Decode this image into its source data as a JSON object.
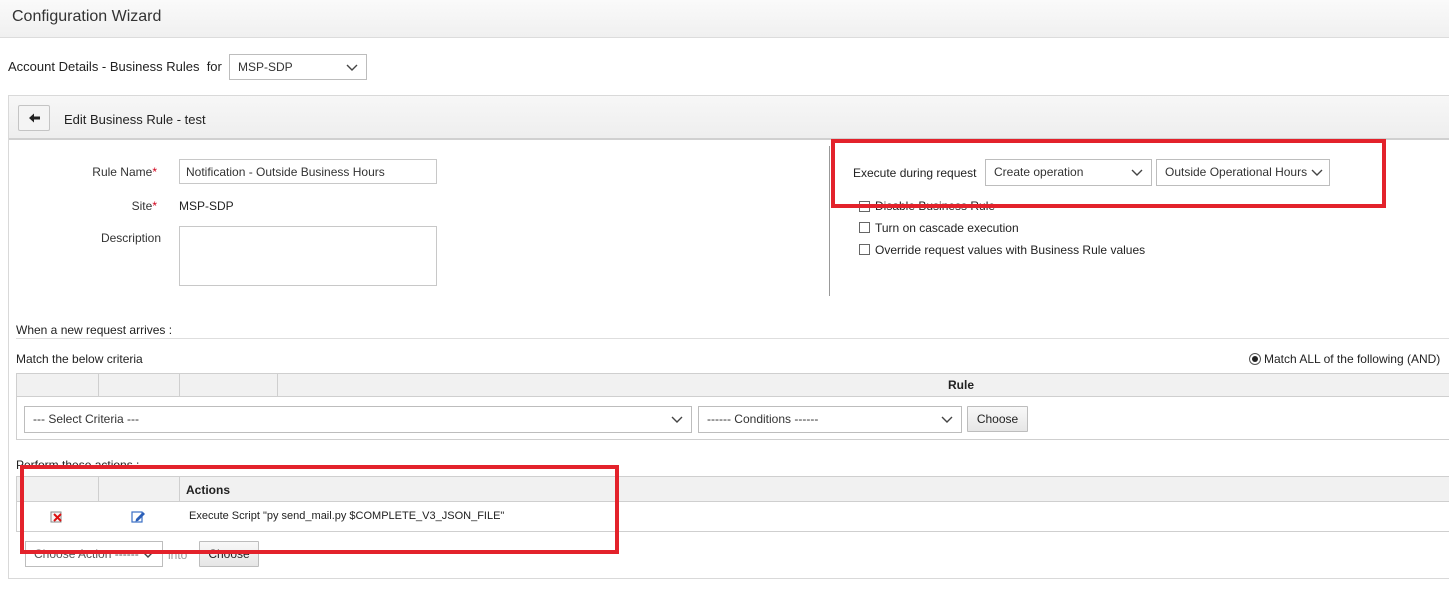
{
  "window": {
    "title": "Configuration Wizard"
  },
  "account": {
    "label": "Account Details - Business Rules  for",
    "selected": "MSP-SDP"
  },
  "panel": {
    "back_icon": "arrow-left-icon",
    "title": "Edit Business Rule - test"
  },
  "form": {
    "rule_name_label": "Rule Name",
    "rule_name_value": "Notification - Outside Business Hours",
    "site_label": "Site",
    "site_value": "MSP-SDP",
    "description_label": "Description",
    "description_value": "",
    "required_marker": "*"
  },
  "execute": {
    "label": "Execute during request",
    "operation_selected": "Create operation",
    "hours_selected": "Outside Operational Hours"
  },
  "options": [
    {
      "label": "Disable Business Rule",
      "checked": false
    },
    {
      "label": "Turn on cascade execution",
      "checked": false
    },
    {
      "label": "Override request values with Business Rule values",
      "checked": false
    }
  ],
  "criteria": {
    "arrives_label": "When a new request arrives :",
    "match_label": "Match the below criteria",
    "match_mode_label": "Match ALL of the following (AND)",
    "rule_column": "Rule",
    "select_criteria": "--- Select Criteria ---",
    "conditions": "------ Conditions ------",
    "choose_label": "Choose"
  },
  "actions": {
    "section_label": "Perform these actions :",
    "column_label": "Actions",
    "rows": [
      {
        "delete_icon": "delete-icon",
        "edit_icon": "edit-icon",
        "text": "Execute Script \"py send_mail.py $COMPLETE_V3_JSON_FILE\""
      }
    ],
    "choose_action": "Choose Action ------",
    "into_label": "into",
    "choose_label": "Choose"
  },
  "colors": {
    "highlight": "#e3222b",
    "required": "#d0021b"
  }
}
